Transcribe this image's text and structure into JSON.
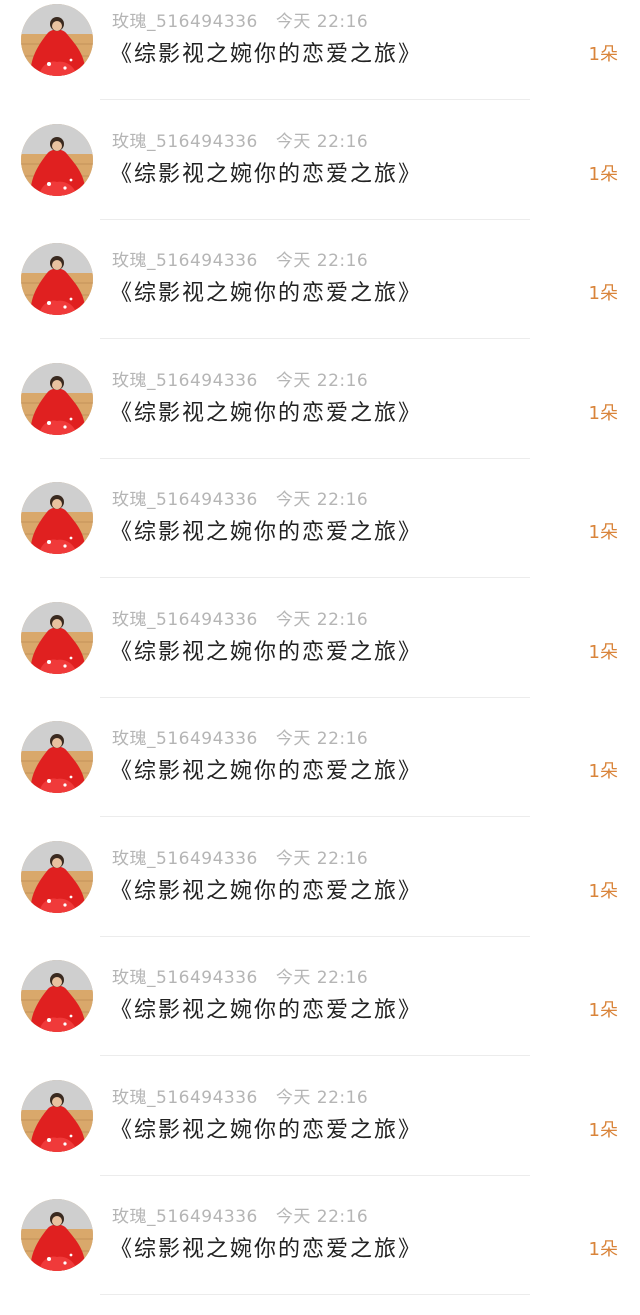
{
  "feed": {
    "items": [
      {
        "user": "玫瑰_516494336",
        "time": "今天 22:16",
        "title": "《综影视之婉你的恋爱之旅》",
        "gift": "1朵"
      },
      {
        "user": "玫瑰_516494336",
        "time": "今天 22:16",
        "title": "《综影视之婉你的恋爱之旅》",
        "gift": "1朵"
      },
      {
        "user": "玫瑰_516494336",
        "time": "今天 22:16",
        "title": "《综影视之婉你的恋爱之旅》",
        "gift": "1朵"
      },
      {
        "user": "玫瑰_516494336",
        "time": "今天 22:16",
        "title": "《综影视之婉你的恋爱之旅》",
        "gift": "1朵"
      },
      {
        "user": "玫瑰_516494336",
        "time": "今天 22:16",
        "title": "《综影视之婉你的恋爱之旅》",
        "gift": "1朵"
      },
      {
        "user": "玫瑰_516494336",
        "time": "今天 22:16",
        "title": "《综影视之婉你的恋爱之旅》",
        "gift": "1朵"
      },
      {
        "user": "玫瑰_516494336",
        "time": "今天 22:16",
        "title": "《综影视之婉你的恋爱之旅》",
        "gift": "1朵"
      },
      {
        "user": "玫瑰_516494336",
        "time": "今天 22:16",
        "title": "《综影视之婉你的恋爱之旅》",
        "gift": "1朵"
      },
      {
        "user": "玫瑰_516494336",
        "time": "今天 22:16",
        "title": "《综影视之婉你的恋爱之旅》",
        "gift": "1朵"
      },
      {
        "user": "玫瑰_516494336",
        "time": "今天 22:16",
        "title": "《综影视之婉你的恋爱之旅》",
        "gift": "1朵"
      },
      {
        "user": "玫瑰_516494336",
        "time": "今天 22:16",
        "title": "《综影视之婉你的恋爱之旅》",
        "gift": "1朵"
      }
    ]
  },
  "colors": {
    "meta_text": "#b5b5b5",
    "title_text": "#222222",
    "gift_text": "#d9843a",
    "avatar_red": "#e02020",
    "avatar_floor": "#d9a86b"
  },
  "icons": {
    "avatar": "user-avatar-photo"
  }
}
